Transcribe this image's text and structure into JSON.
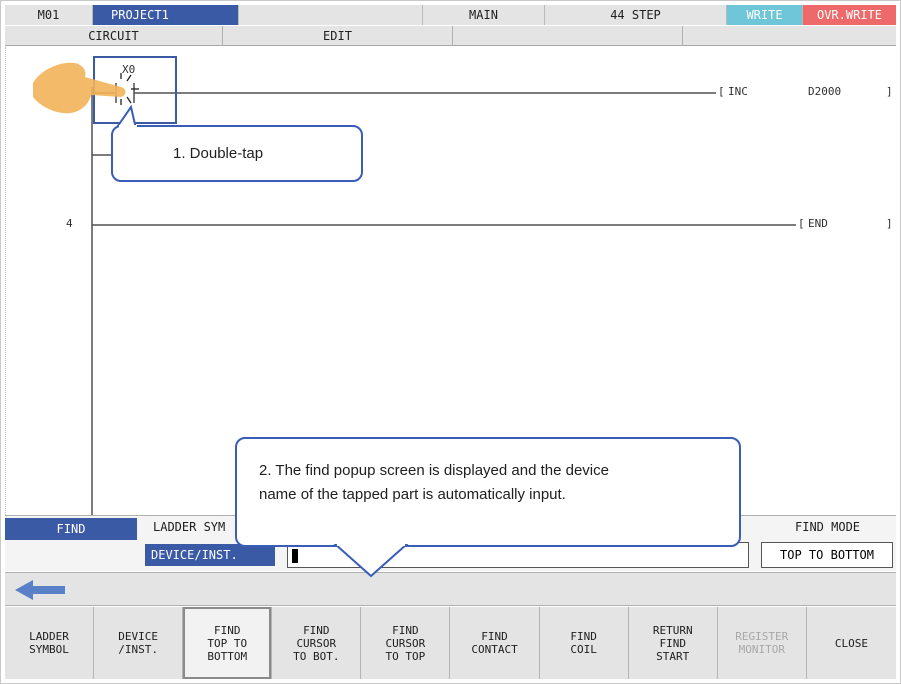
{
  "status_bar": {
    "plc": "M01",
    "project": "PROJECT1",
    "program": "MAIN",
    "steps": "44 STEP",
    "mode": "WRITE",
    "insert_mode": "OVR.WRITE"
  },
  "tabs": [
    "CIRCUIT",
    "EDIT"
  ],
  "ladder": {
    "contact_device": "X0",
    "instruction_1": {
      "name": "INC",
      "operand": "D2000"
    },
    "step_number": "4",
    "instruction_2": {
      "name": "END"
    }
  },
  "callouts": {
    "step1": "1. Double-tap",
    "step2_line1": "2. The find popup screen is displayed and the device",
    "step2_line2": "name of the tapped part is automatically input."
  },
  "find_popup": {
    "title": "FIND",
    "type_label": "LADDER SYM",
    "device_label": "DEVICE/INST.",
    "input_value": "",
    "mode_label": "FIND MODE",
    "mode_value": "TOP TO BOTTOM"
  },
  "function_keys": [
    {
      "label": "LADDER\nSYMBOL"
    },
    {
      "label": "DEVICE\n/INST."
    },
    {
      "label": "FIND\nTOP TO\nBOTTOM"
    },
    {
      "label": "FIND\nCURSOR\nTO BOT."
    },
    {
      "label": "FIND\nCURSOR\nTO TOP"
    },
    {
      "label": "FIND\nCONTACT"
    },
    {
      "label": "FIND\nCOIL"
    },
    {
      "label": "RETURN\nFIND\nSTART"
    },
    {
      "label": "REGISTER\nMONITOR"
    },
    {
      "label": "CLOSE"
    }
  ],
  "colors": {
    "accent_blue": "#3b5aa6",
    "write_badge": "#6ec6d8",
    "overwrite_badge": "#ee6a6a",
    "callout_border": "#3a5db8"
  },
  "icons": {
    "back": "left-arrow-icon",
    "tap": "hand-pointer-icon"
  }
}
